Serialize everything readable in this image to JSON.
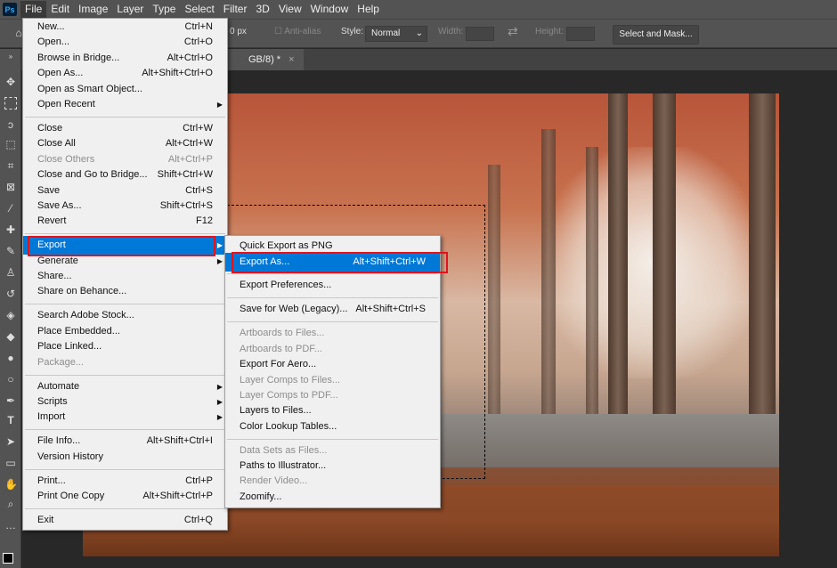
{
  "app": {
    "logo": "Ps",
    "accent": "#0078d7",
    "highlight_box_color": "#e0141e"
  },
  "menubar": [
    "File",
    "Edit",
    "Image",
    "Layer",
    "Type",
    "Select",
    "Filter",
    "3D",
    "View",
    "Window",
    "Help"
  ],
  "options": {
    "feather_value": "0 px",
    "anti_alias": "Anti-alias",
    "style_label": "Style:",
    "style_value": "Normal",
    "width_label": "Width:",
    "height_label": "Height:",
    "select_mask": "Select and Mask..."
  },
  "document_tab": {
    "title": "GB/8) *",
    "close": "×"
  },
  "file_menu": [
    {
      "label": "New...",
      "shortcut": "Ctrl+N"
    },
    {
      "label": "Open...",
      "shortcut": "Ctrl+O"
    },
    {
      "label": "Browse in Bridge...",
      "shortcut": "Alt+Ctrl+O"
    },
    {
      "label": "Open As...",
      "shortcut": "Alt+Shift+Ctrl+O"
    },
    {
      "label": "Open as Smart Object..."
    },
    {
      "label": "Open Recent",
      "submenu": true
    },
    {
      "sep": true
    },
    {
      "label": "Close",
      "shortcut": "Ctrl+W"
    },
    {
      "label": "Close All",
      "shortcut": "Alt+Ctrl+W"
    },
    {
      "label": "Close Others",
      "shortcut": "Alt+Ctrl+P",
      "disabled": true
    },
    {
      "label": "Close and Go to Bridge...",
      "shortcut": "Shift+Ctrl+W"
    },
    {
      "label": "Save",
      "shortcut": "Ctrl+S"
    },
    {
      "label": "Save As...",
      "shortcut": "Shift+Ctrl+S"
    },
    {
      "label": "Revert",
      "shortcut": "F12"
    },
    {
      "sep": true
    },
    {
      "label": "Export",
      "submenu": true,
      "highlighted": true
    },
    {
      "label": "Generate",
      "submenu": true
    },
    {
      "label": "Share..."
    },
    {
      "label": "Share on Behance..."
    },
    {
      "sep": true
    },
    {
      "label": "Search Adobe Stock..."
    },
    {
      "label": "Place Embedded..."
    },
    {
      "label": "Place Linked..."
    },
    {
      "label": "Package...",
      "disabled": true
    },
    {
      "sep": true
    },
    {
      "label": "Automate",
      "submenu": true
    },
    {
      "label": "Scripts",
      "submenu": true
    },
    {
      "label": "Import",
      "submenu": true
    },
    {
      "sep": true
    },
    {
      "label": "File Info...",
      "shortcut": "Alt+Shift+Ctrl+I"
    },
    {
      "label": "Version History"
    },
    {
      "sep": true
    },
    {
      "label": "Print...",
      "shortcut": "Ctrl+P"
    },
    {
      "label": "Print One Copy",
      "shortcut": "Alt+Shift+Ctrl+P"
    },
    {
      "sep": true
    },
    {
      "label": "Exit",
      "shortcut": "Ctrl+Q"
    }
  ],
  "export_menu": [
    {
      "label": "Quick Export as PNG"
    },
    {
      "label": "Export As...",
      "shortcut": "Alt+Shift+Ctrl+W",
      "highlighted": true
    },
    {
      "sep": true
    },
    {
      "label": "Export Preferences..."
    },
    {
      "sep": true
    },
    {
      "label": "Save for Web (Legacy)...",
      "shortcut": "Alt+Shift+Ctrl+S"
    },
    {
      "sep": true
    },
    {
      "label": "Artboards to Files...",
      "disabled": true
    },
    {
      "label": "Artboards to PDF...",
      "disabled": true
    },
    {
      "label": "Export For Aero..."
    },
    {
      "label": "Layer Comps to Files...",
      "disabled": true
    },
    {
      "label": "Layer Comps to PDF...",
      "disabled": true
    },
    {
      "label": "Layers to Files..."
    },
    {
      "label": "Color Lookup Tables..."
    },
    {
      "sep": true
    },
    {
      "label": "Data Sets as Files...",
      "disabled": true
    },
    {
      "label": "Paths to Illustrator..."
    },
    {
      "label": "Render Video...",
      "disabled": true
    },
    {
      "label": "Zoomify..."
    }
  ]
}
